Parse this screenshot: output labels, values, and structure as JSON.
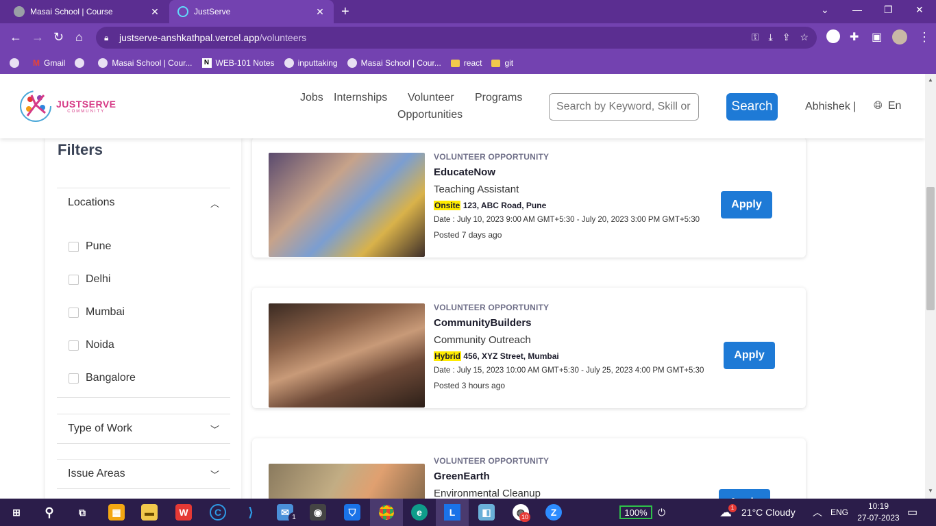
{
  "browser": {
    "tabs": [
      {
        "title": "Masai School | Course",
        "active": false
      },
      {
        "title": "JustServe",
        "active": true
      }
    ],
    "url_host": "justserve-anshkathpal.vercel.app",
    "url_path": "/volunteers",
    "bookmarks": [
      {
        "label": "",
        "icon": "globe-icon"
      },
      {
        "label": "Gmail",
        "icon": "gmail-icon"
      },
      {
        "label": "",
        "icon": "globe-icon"
      },
      {
        "label": "Masai School | Cour...",
        "icon": "globe-icon"
      },
      {
        "label": "WEB-101 Notes",
        "icon": "notion-icon"
      },
      {
        "label": "inputtaking",
        "icon": "globe-icon"
      },
      {
        "label": "Masai School | Cour...",
        "icon": "globe-icon"
      },
      {
        "label": "react",
        "icon": "folder-icon"
      },
      {
        "label": "git",
        "icon": "folder-icon"
      }
    ]
  },
  "header": {
    "logo_brand": "JUSTSERVE",
    "logo_sub": "COMMUNITY",
    "nav": [
      "Jobs",
      "Internships",
      "Volunteer",
      "Opportunities",
      "Programs"
    ],
    "search_placeholder": "Search by Keyword, Skill or I",
    "search_button": "Search",
    "user": "Abhishek  |",
    "lang": "En"
  },
  "filters": {
    "title": "Filters",
    "locations_label": "Locations",
    "locations": [
      "Pune",
      "Delhi",
      "Mumbai",
      "Noida",
      "Bangalore"
    ],
    "type_of_work_label": "Type of Work",
    "issue_areas_label": "Issue Areas"
  },
  "opportunities": [
    {
      "kind": "VOLUNTEER OPPORTUNITY",
      "org": "EducateNow",
      "role": "Teaching Assistant",
      "mode": "Onsite",
      "address": "123, ABC Road, Pune",
      "date": "Date : July 10, 2023 9:00 AM GMT+5:30 - July 20, 2023 3:00 PM GMT+5:30",
      "posted": "Posted 7 days ago",
      "apply": "Apply"
    },
    {
      "kind": "VOLUNTEER OPPORTUNITY",
      "org": "CommunityBuilders",
      "role": "Community Outreach",
      "mode": "Hybrid",
      "address": "456, XYZ Street, Mumbai",
      "date": "Date : July 15, 2023 10:00 AM GMT+5:30 - July 25, 2023 4:00 PM GMT+5:30",
      "posted": "Posted 3 hours ago",
      "apply": "Apply"
    },
    {
      "kind": "VOLUNTEER OPPORTUNITY",
      "org": "GreenEarth",
      "role": "Environmental Cleanup",
      "apply": "Apply"
    }
  ],
  "taskbar": {
    "battery": "100%",
    "weather": "21°C  Cloudy",
    "lang": "ENG",
    "time": "10:19",
    "date": "27-07-2023",
    "mail_badge": "1",
    "chrome_badge": "10",
    "weather_badge": "1"
  }
}
